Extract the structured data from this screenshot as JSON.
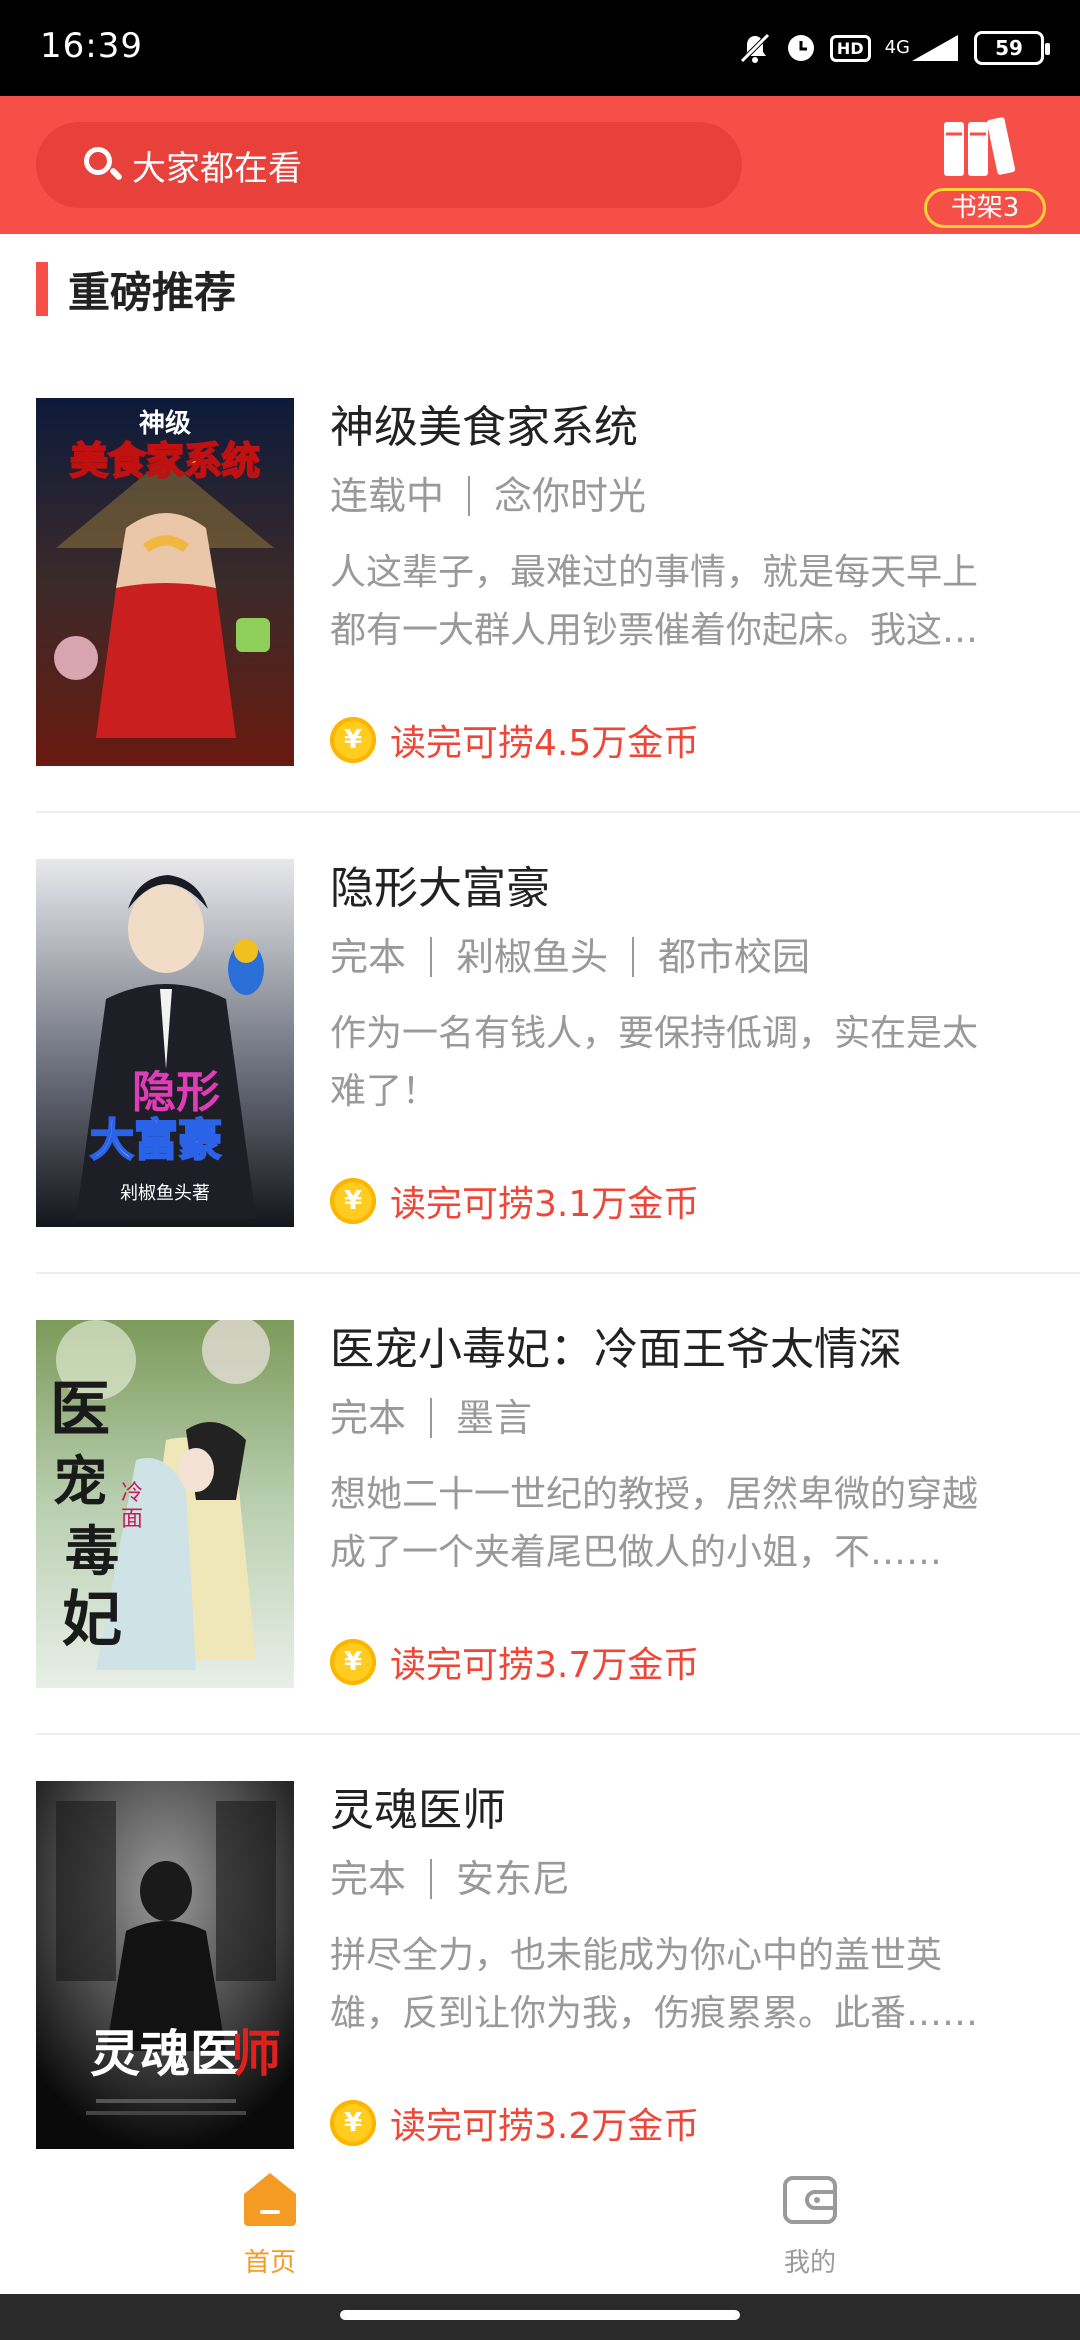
{
  "status_bar": {
    "time": "16:39",
    "icons": [
      "mute-icon",
      "alarm-icon",
      "hd-icon",
      "signal-4g-icon",
      "battery-icon"
    ],
    "hd_label": "HD",
    "network_label": "4G",
    "battery_level": "59"
  },
  "header": {
    "search_placeholder": "大家都在看",
    "bookshelf_label": "书架3",
    "colors": {
      "header_bg": "#f64f48",
      "badge_border": "#ffd23a"
    }
  },
  "section": {
    "title": "重磅推荐"
  },
  "books": [
    {
      "title": "神级美食家系统",
      "meta": [
        "连载中",
        "念你时光"
      ],
      "description": "人这辈子，最难过的事情，就是每天早上都有一大群人用钞票催着你起床。我这辈子，最难过的事情，就是……",
      "reward": "读完可捞4.5万金币",
      "cover_title": "神级美食家系统"
    },
    {
      "title": "隐形大富豪",
      "meta": [
        "完本",
        "剁椒鱼头",
        "都市校园"
      ],
      "description": "作为一名有钱人，要保持低调，实在是太难了！",
      "reward": "读完可捞3.1万金币",
      "cover_title": "隐形大富豪",
      "cover_author": "剁椒鱼头著"
    },
    {
      "title": "医宠小毒妃：冷面王爷太情深",
      "meta": [
        "完本",
        "墨言"
      ],
      "description": "想她二十一世纪的教授，居然卑微的穿越成了一个夹着尾巴做人的小姐，不……",
      "reward": "读完可捞3.7万金币",
      "cover_title": "医宠小毒妃",
      "cover_subtitle": "冷面王爷太情深"
    },
    {
      "title": "灵魂医师",
      "meta": [
        "完本",
        "安东尼"
      ],
      "description": "拼尽全力，也未能成为你心中的盖世英雄，反到让你为我，伤痕累累。此番……",
      "reward": "读完可捞3.2万金币",
      "cover_title": "灵魂医师"
    }
  ],
  "bottom_nav": {
    "items": [
      {
        "label": "首页",
        "icon": "home-icon",
        "active": true
      },
      {
        "label": "我的",
        "icon": "wallet-icon",
        "active": false
      }
    ],
    "colors": {
      "active": "#f59a22",
      "inactive": "#9a9a9a"
    }
  }
}
